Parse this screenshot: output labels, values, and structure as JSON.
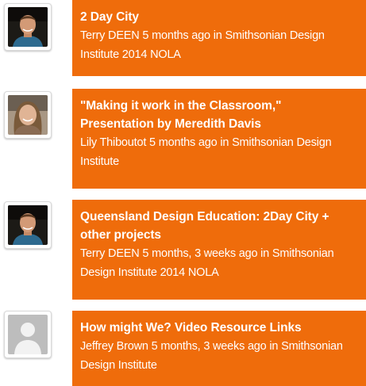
{
  "colors": {
    "card_background": "#ef6c0b",
    "card_text": "#ffffff",
    "avatar_border": "#d9d9d9",
    "placeholder_bg": "#bdbdbd",
    "placeholder_fg": "#f2f2f2"
  },
  "activities": [
    {
      "title": "2 Day City",
      "author": "Terry DEEN",
      "time": "5 months ago",
      "connector": "in",
      "group": "Smithsonian Design Institute 2014 NOLA",
      "avatar": "photo-man"
    },
    {
      "title": "\"Making it work in the Classroom,\" Presentation by Meredith Davis",
      "author": "Lily Thiboutot",
      "time": "5 months ago",
      "connector": "in",
      "group": "Smithsonian Design Institute",
      "avatar": "photo-woman"
    },
    {
      "title": "Queensland Design Education: 2Day City + other projects",
      "author": "Terry DEEN",
      "time": "5 months, 3 weeks ago",
      "connector": "in",
      "group": "Smithsonian Design Institute 2014 NOLA",
      "avatar": "photo-man"
    },
    {
      "title": "How might We? Video Resource Links",
      "author": "Jeffrey Brown",
      "time": "5 months, 3 weeks ago",
      "connector": "in",
      "group": "Smithsonian Design Institute",
      "avatar": "placeholder-user-icon"
    }
  ]
}
